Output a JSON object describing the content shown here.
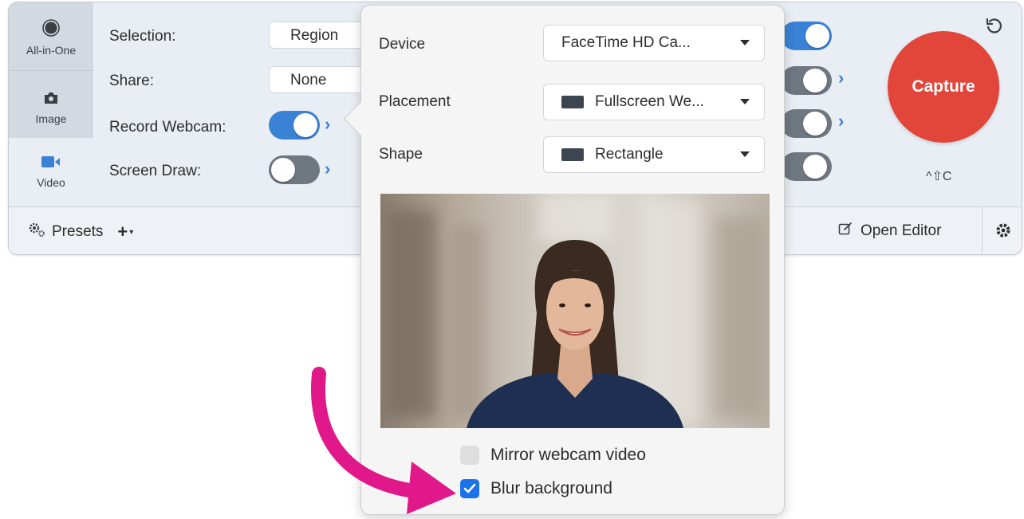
{
  "modes": [
    {
      "label": "All-in-One",
      "icon": "record-icon"
    },
    {
      "label": "Image",
      "icon": "camera-icon"
    },
    {
      "label": "Video",
      "icon": "video-camera-icon"
    }
  ],
  "options": {
    "selection_label": "Selection:",
    "selection_value": "Region",
    "share_label": "Share:",
    "share_value": "None",
    "webcam_label": "Record Webcam:",
    "webcam_on": true,
    "draw_label": "Screen Draw:",
    "draw_on": false
  },
  "capture": {
    "label": "Capture",
    "shortcut": "^⇧C",
    "color": "#e2453a"
  },
  "bottom": {
    "presets_label": "Presets",
    "open_editor_label": "Open Editor"
  },
  "popover": {
    "device_label": "Device",
    "device_value": "FaceTime HD Ca...",
    "placement_label": "Placement",
    "placement_value": "Fullscreen We...",
    "shape_label": "Shape",
    "shape_value": "Rectangle",
    "mirror_label": "Mirror webcam video",
    "mirror_checked": false,
    "blur_label": "Blur background",
    "blur_checked": true
  },
  "colors": {
    "accent": "#3a82d5",
    "annotation_arrow": "#e0188a"
  }
}
